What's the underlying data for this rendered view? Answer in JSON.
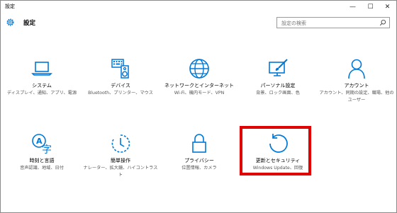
{
  "window": {
    "title": "設定",
    "controls": {
      "minimize": "—",
      "maximize": "☐",
      "close": "✕"
    }
  },
  "header": {
    "title": "設定",
    "search_placeholder": "設定の検索"
  },
  "accent_color": "#0078d7",
  "highlight_color": "#e00000",
  "tiles": [
    {
      "icon": "laptop-icon",
      "label": "システム",
      "desc": "ディスプレイ、通知、アプリ、電源"
    },
    {
      "icon": "keyboard-speaker-icon",
      "label": "デバイス",
      "desc": "Bluetooth、プリンター、マウス"
    },
    {
      "icon": "globe-icon",
      "label": "ネットワークとインターネット",
      "desc": "Wi-Fi、機内モード、VPN"
    },
    {
      "icon": "paintbrush-monitor-icon",
      "label": "パーソナル設定",
      "desc": "背景、ロック画面、色"
    },
    {
      "icon": "person-icon",
      "label": "アカウント",
      "desc": "アカウント、同期の設定、職場、他のユーザー"
    },
    {
      "icon": "clock-language-icon",
      "label": "時刻と言語",
      "desc": "音声認識、地域、日付"
    },
    {
      "icon": "ease-of-access-icon",
      "label": "簡単操作",
      "desc": "ナレーター、拡大鏡、ハイコントラスト"
    },
    {
      "icon": "lock-icon",
      "label": "プライバシー",
      "desc": "位置情報、カメラ"
    },
    {
      "icon": "refresh-icon",
      "label": "更新とセキュリティ",
      "desc": "Windows Update、回復"
    }
  ]
}
